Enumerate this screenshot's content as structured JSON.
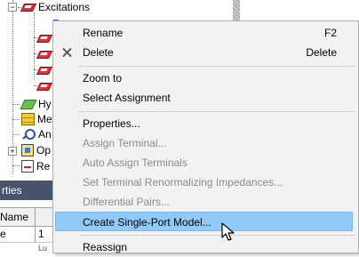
{
  "tree": {
    "excitations_label": "Excitations",
    "partial_items": [
      "Hy",
      "Me",
      "An",
      "Op",
      "Re"
    ]
  },
  "properties_panel": {
    "header_label": "rties",
    "grid_headers": [
      "Name",
      ""
    ],
    "row": [
      "e",
      "1"
    ],
    "partial_row": "Lu"
  },
  "context_menu": {
    "items": [
      {
        "label": "Rename",
        "shortcut": "F2",
        "enabled": true
      },
      {
        "label": "Delete",
        "shortcut": "Delete",
        "enabled": true,
        "icon": "close-icon"
      },
      {
        "label": "Zoom to",
        "enabled": true
      },
      {
        "label": "Select Assignment",
        "enabled": true
      },
      {
        "label": "Properties...",
        "enabled": true
      },
      {
        "label": "Assign Terminal...",
        "enabled": false
      },
      {
        "label": "Auto Assign Terminals",
        "enabled": false
      },
      {
        "label": "Set Terminal Renormalizing Impedances...",
        "enabled": false
      },
      {
        "label": "Differential Pairs...",
        "enabled": false
      },
      {
        "label": "Create Single-Port Model...",
        "enabled": true,
        "highlighted": true
      },
      {
        "label": "Reassign",
        "enabled": true
      }
    ]
  },
  "colors": {
    "menu_bg": "#f2f2f2",
    "highlight": "#91c9f7",
    "disabled_text": "#8a8a8a",
    "panel_header": "#49536b"
  }
}
